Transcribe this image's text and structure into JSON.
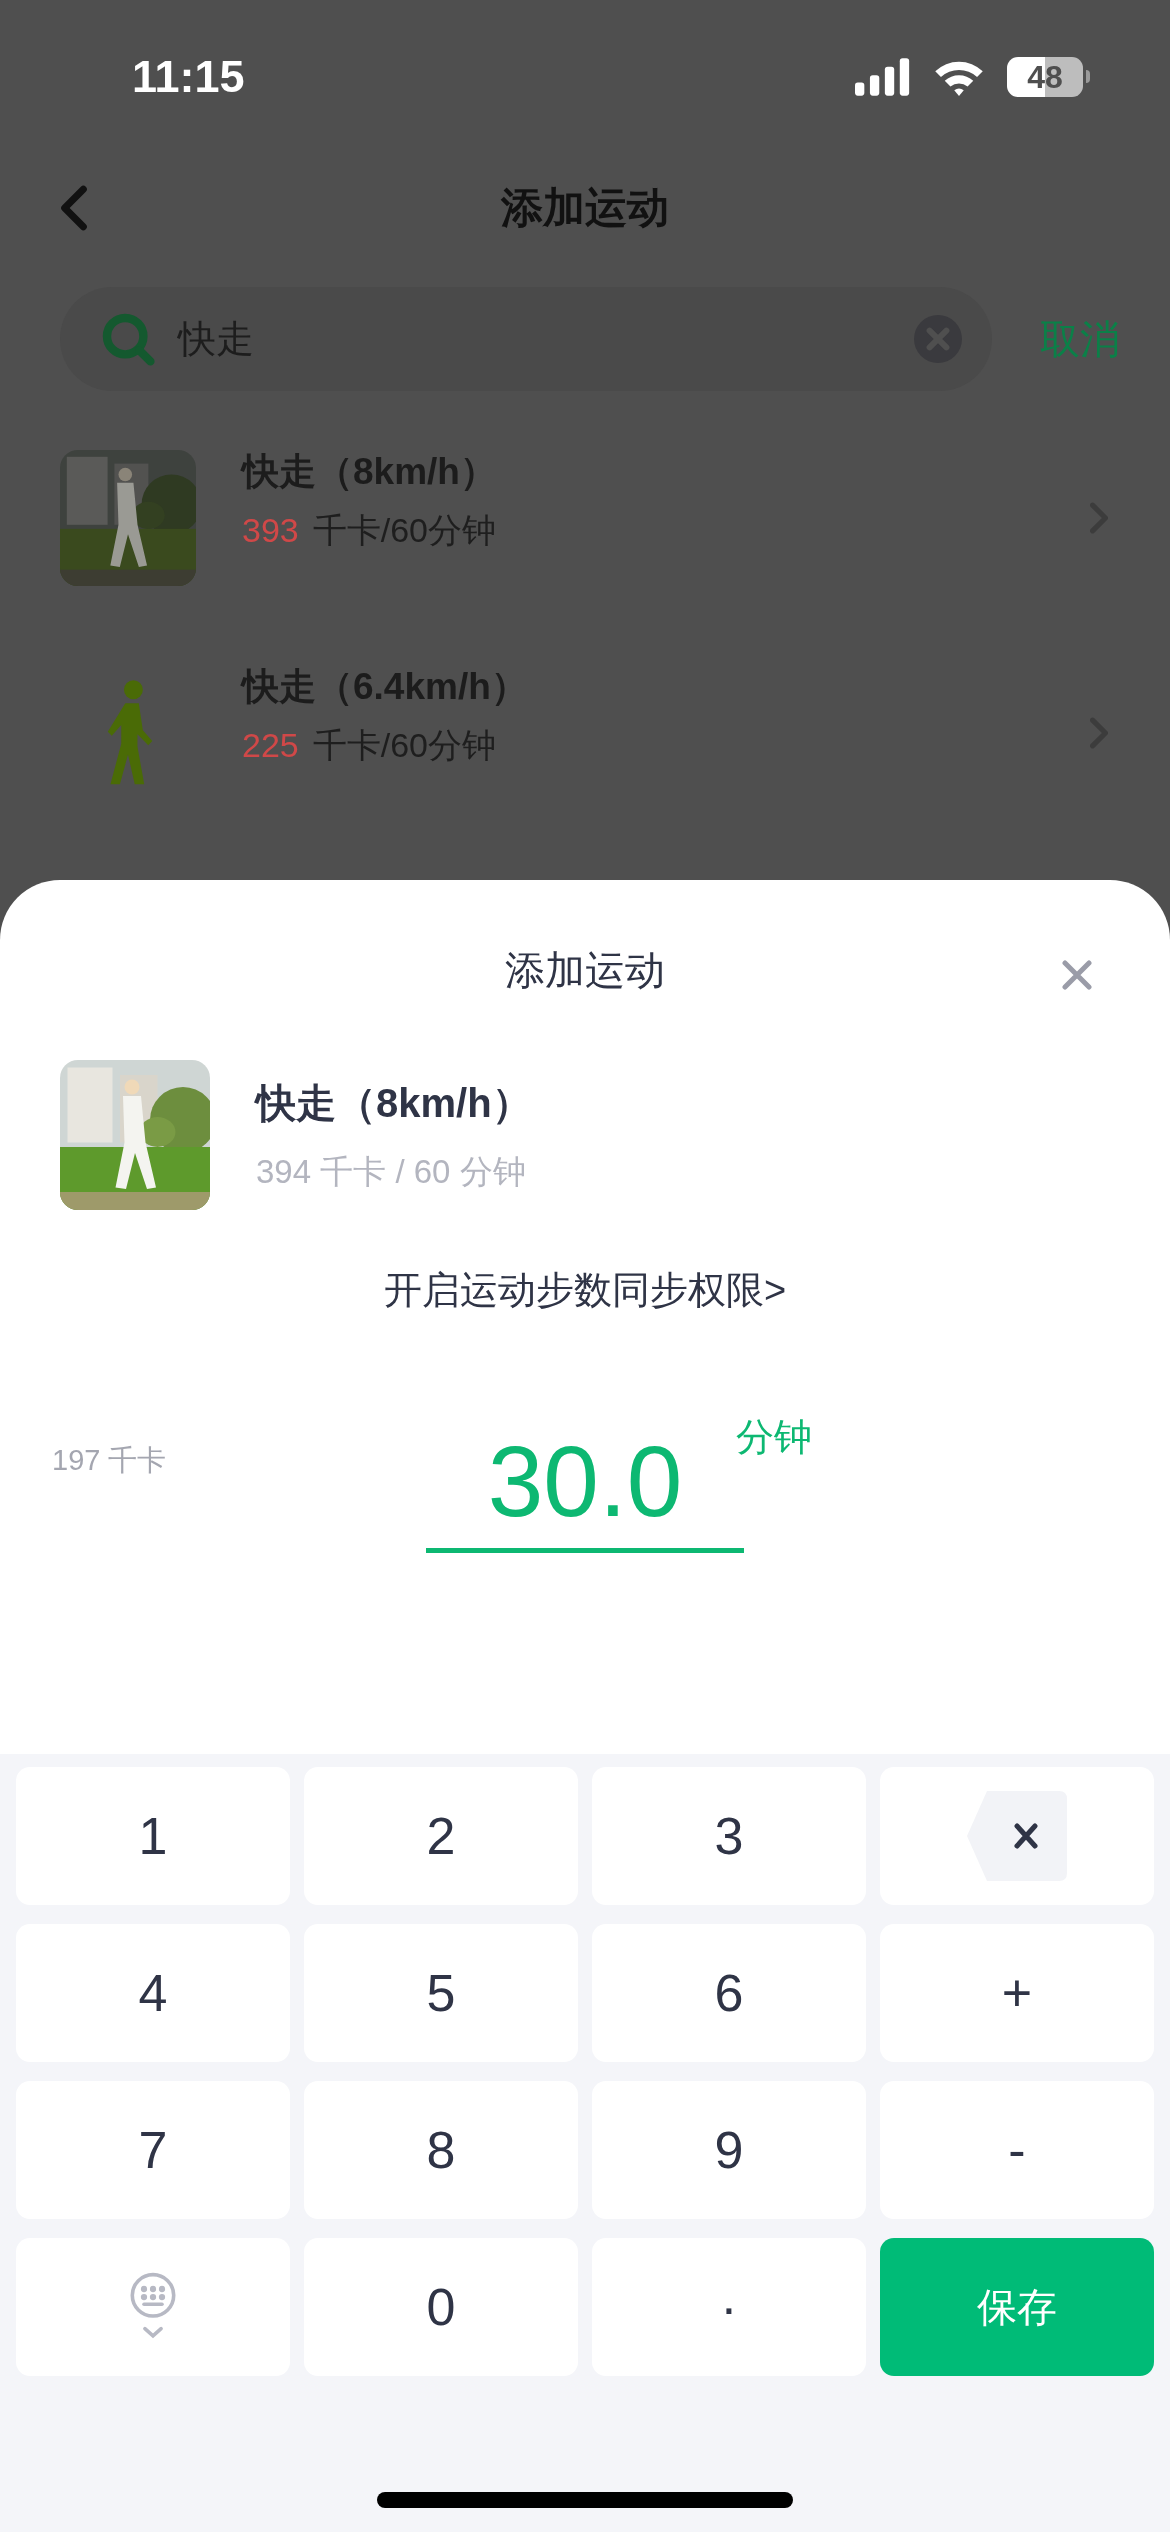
{
  "status_bar": {
    "time": "11:15",
    "battery": "48"
  },
  "nav": {
    "title": "添加运动"
  },
  "search": {
    "value": "快走",
    "cancel": "取消"
  },
  "results": [
    {
      "name": "快走（8km/h）",
      "calories": "393",
      "unit": "千卡/60分钟"
    },
    {
      "kind": "figure",
      "name": "快走（6.4km/h）",
      "calories": "225",
      "unit": "千卡/60分钟"
    }
  ],
  "sheet": {
    "title": "添加运动",
    "item": {
      "name": "快走（8km/h）",
      "detail": "394 千卡 / 60 分钟"
    },
    "sync_link": "开启运动步数同步权限>",
    "calories": "197 千卡",
    "duration": "30.0",
    "unit": "分钟"
  },
  "keypad": [
    {
      "kind": "key",
      "label": "1"
    },
    {
      "kind": "key",
      "label": "2"
    },
    {
      "kind": "key",
      "label": "3"
    },
    {
      "kind": "backspace"
    },
    {
      "kind": "key",
      "label": "4"
    },
    {
      "kind": "key",
      "label": "5"
    },
    {
      "kind": "key",
      "label": "6"
    },
    {
      "kind": "key",
      "label": "+"
    },
    {
      "kind": "key",
      "label": "7"
    },
    {
      "kind": "key",
      "label": "8"
    },
    {
      "kind": "key",
      "label": "9"
    },
    {
      "kind": "key",
      "label": "-"
    },
    {
      "kind": "hide"
    },
    {
      "kind": "key",
      "label": "0"
    },
    {
      "kind": "key",
      "label": "·"
    },
    {
      "kind": "save",
      "label": "保存"
    }
  ]
}
